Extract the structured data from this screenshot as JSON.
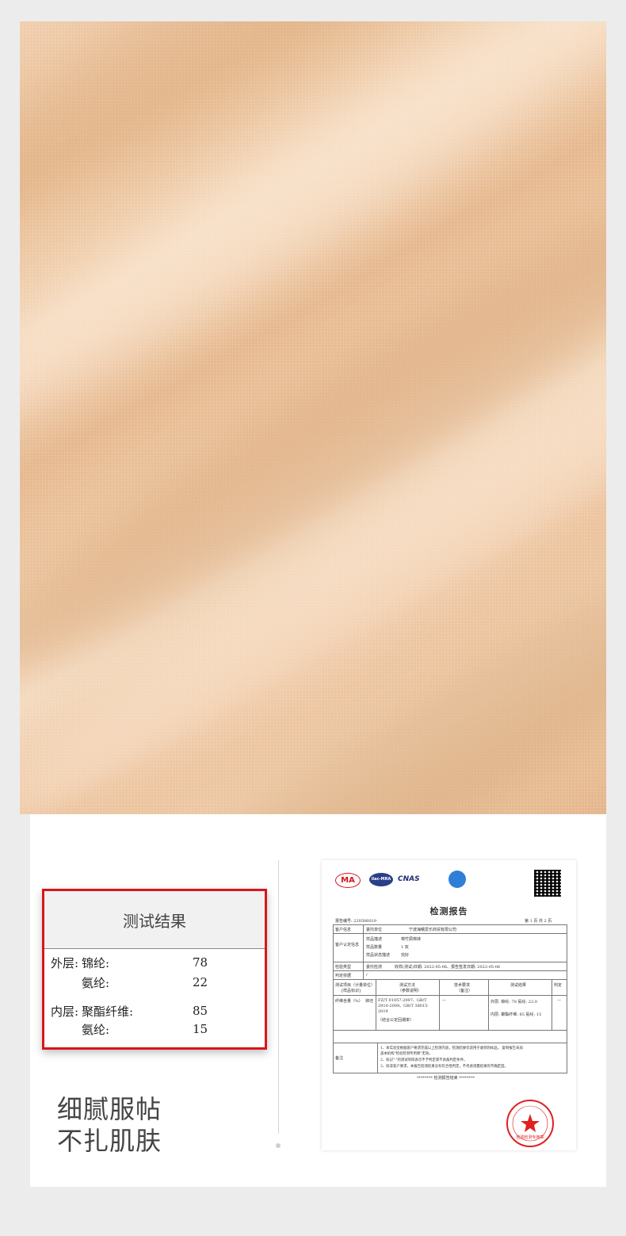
{
  "results": {
    "title": "测试结果",
    "rows": [
      {
        "label": "外层:",
        "material": "锦纶:",
        "value": "78"
      },
      {
        "label": "",
        "material": "氨纶:",
        "value": "22"
      },
      {
        "label": "内层:",
        "material": "聚酯纤维:",
        "value": "85"
      },
      {
        "label": "",
        "material": "氨纶:",
        "value": "15"
      }
    ]
  },
  "slogan": {
    "line1": "细腻服帖",
    "line2": "不扎肌肤"
  },
  "report": {
    "title": "检测报告",
    "report_no": "报告编号: 220506019",
    "page": "第 1 页 共 2 页",
    "logos": {
      "ma": "MA",
      "ilac": "ilac-MRA",
      "cnas": "CNAS"
    },
    "client_label": "客户信息",
    "client_sub": "委托单位",
    "client_value": "宁波海曙爱乐商贸有限公司",
    "sample_label": "客户认定信息",
    "sample_name_k": "样品描述",
    "sample_name_v": "棉竹屑棉袜",
    "sample_qty_k": "样品数量",
    "sample_qty_v": "1 双",
    "sample_state_k": "样品状态描述",
    "sample_state_v": "完好",
    "test_type_label": "检验类型",
    "test_type_v": "委托检测",
    "dates": "收样(测试)日期: 2022-05-06、报告签发日期: 2022-05-06",
    "basis_label": "判定依据",
    "basis_v": "/",
    "col_item": "测试项目（计量单位）",
    "col_item_sub": "[样品标识]",
    "col_method": "测试方法",
    "col_method_sub": "（参数说明）",
    "col_req": "技术要求",
    "col_req_sub": "（备注）",
    "col_result": "测试结果",
    "col_judge": "判定",
    "item_name": "纤维含量（%）",
    "item_sub": "袜坯",
    "method": "FZ/T 01057-2007、GB/T 2910-2009、GB/T 38015-2019",
    "method_sub": "（结合公定回潮率）",
    "req": "—",
    "res1": "外层: 锦纶: 78 氨纶: 22.0",
    "res2": "内层: 聚酯纤维: 85 氨纶: 15",
    "judge": "—",
    "notes_label": "备注",
    "note1": "1、本实验室根据客户要求完成以上检测内容，检测结果仅适用于收到的样品。 复制报告未加",
    "note1b": "盖本机构\"检验检测专用章\"无效。",
    "note2": "2、标记\"-\"的测试项目表示不予判定或不具备判定条件。",
    "note3": "3、除非客户要求，本报告检测结果没有符合性判定，不考虑测量结果的不确定度。",
    "end": "******** 检测报告结束 ********",
    "seal_text": "检验检测专用章"
  },
  "colors": {
    "accent_red": "#d8161b",
    "fabric": "#ecc39c"
  }
}
